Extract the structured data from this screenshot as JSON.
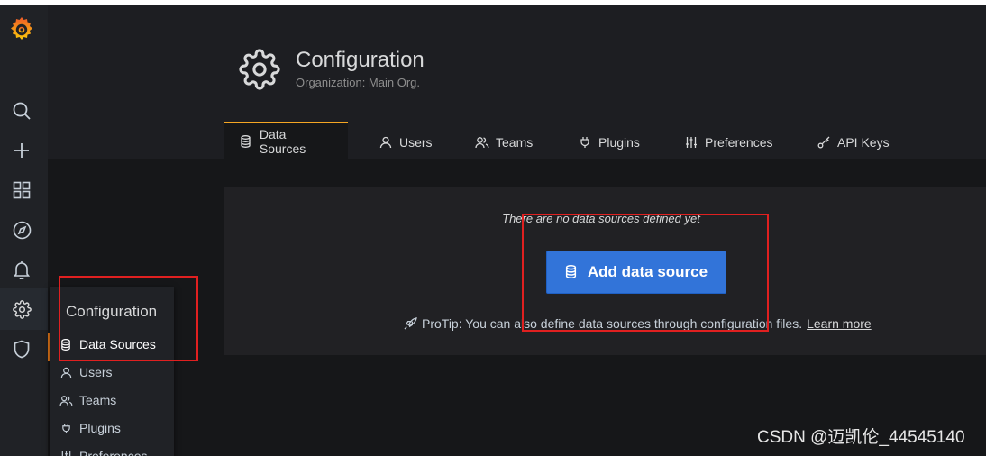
{
  "header": {
    "title": "Configuration",
    "subtitle": "Organization: Main Org."
  },
  "tabs": [
    {
      "label": "Data Sources",
      "icon": "database-icon",
      "active": true
    },
    {
      "label": "Users",
      "icon": "user-icon",
      "active": false
    },
    {
      "label": "Teams",
      "icon": "users-icon",
      "active": false
    },
    {
      "label": "Plugins",
      "icon": "plug-icon",
      "active": false
    },
    {
      "label": "Preferences",
      "icon": "sliders-icon",
      "active": false
    },
    {
      "label": "API Keys",
      "icon": "key-icon",
      "active": false
    }
  ],
  "sidebar": {
    "icons": [
      "grafana-logo",
      "search-icon",
      "plus-icon",
      "dashboards-icon",
      "compass-icon",
      "bell-icon",
      "gear-icon",
      "shield-icon"
    ]
  },
  "flyout": {
    "title": "Configuration",
    "items": [
      {
        "label": "Data Sources",
        "icon": "database-icon",
        "active": true
      },
      {
        "label": "Users",
        "icon": "user-icon"
      },
      {
        "label": "Teams",
        "icon": "users-icon"
      },
      {
        "label": "Plugins",
        "icon": "plug-icon"
      },
      {
        "label": "Preferences",
        "icon": "sliders-icon"
      }
    ]
  },
  "empty_state": {
    "message": "There are no data sources defined yet",
    "button_label": "Add data source",
    "protip": "ProTip: You can also define data sources through configuration files.",
    "learn_more": "Learn more"
  },
  "watermark": "CSDN @迈凯伦_44545140",
  "colors": {
    "accent": "#eb7b18",
    "primary_button": "#3274d9",
    "annotation": "#e02020"
  }
}
